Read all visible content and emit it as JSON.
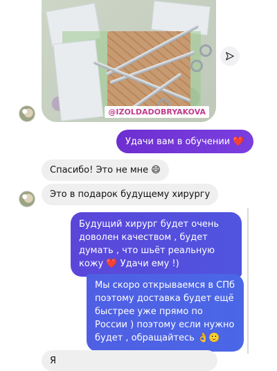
{
  "post": {
    "watermark": "@IZOLDADOBRYAKOVA",
    "share_icon": "paper-plane-icon"
  },
  "messages": [
    {
      "side": "out",
      "text": "Удачи вам в обучении ❤️"
    },
    {
      "side": "in",
      "text": "Спасибо! Это не мне 😄"
    },
    {
      "side": "in",
      "text": "Это в подарок будущему хирургу"
    },
    {
      "side": "out",
      "text": "Будущий хирург будет очень доволен качеством , будет думать , что шьёт реальную кожу ❤️ Удачи ему !)"
    },
    {
      "side": "out",
      "text": "Мы скоро открываемся в СПб поэтому доставка будет ещё быстрее уже прямо по России ) поэтому если нужно будет , обращайтесь 👌🙂"
    },
    {
      "side": "in",
      "text": "Я"
    }
  ],
  "colors": {
    "outgoing_start": "#6d2fd0",
    "outgoing_end": "#4a67e6",
    "incoming": "#efefef",
    "watermark": "#c03c8c"
  }
}
